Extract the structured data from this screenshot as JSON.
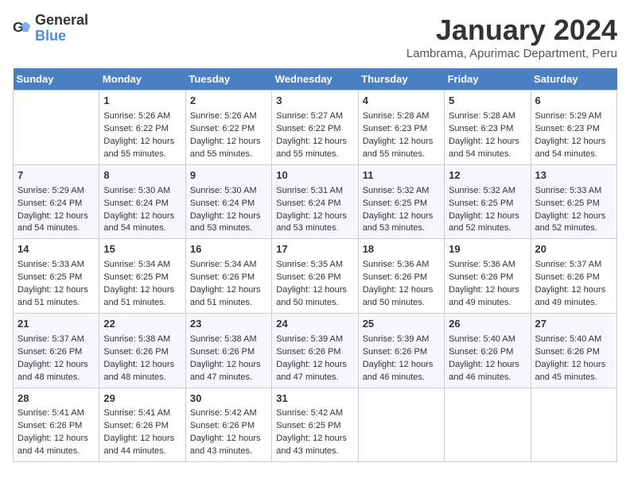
{
  "header": {
    "logo_general": "General",
    "logo_blue": "Blue",
    "month_title": "January 2024",
    "location": "Lambrama, Apurimac Department, Peru"
  },
  "days_of_week": [
    "Sunday",
    "Monday",
    "Tuesday",
    "Wednesday",
    "Thursday",
    "Friday",
    "Saturday"
  ],
  "weeks": [
    [
      {
        "day": "",
        "content": ""
      },
      {
        "day": "1",
        "content": "Sunrise: 5:26 AM\nSunset: 6:22 PM\nDaylight: 12 hours\nand 55 minutes."
      },
      {
        "day": "2",
        "content": "Sunrise: 5:26 AM\nSunset: 6:22 PM\nDaylight: 12 hours\nand 55 minutes."
      },
      {
        "day": "3",
        "content": "Sunrise: 5:27 AM\nSunset: 6:22 PM\nDaylight: 12 hours\nand 55 minutes."
      },
      {
        "day": "4",
        "content": "Sunrise: 5:28 AM\nSunset: 6:23 PM\nDaylight: 12 hours\nand 55 minutes."
      },
      {
        "day": "5",
        "content": "Sunrise: 5:28 AM\nSunset: 6:23 PM\nDaylight: 12 hours\nand 54 minutes."
      },
      {
        "day": "6",
        "content": "Sunrise: 5:29 AM\nSunset: 6:23 PM\nDaylight: 12 hours\nand 54 minutes."
      }
    ],
    [
      {
        "day": "7",
        "content": "Sunrise: 5:29 AM\nSunset: 6:24 PM\nDaylight: 12 hours\nand 54 minutes."
      },
      {
        "day": "8",
        "content": "Sunrise: 5:30 AM\nSunset: 6:24 PM\nDaylight: 12 hours\nand 54 minutes."
      },
      {
        "day": "9",
        "content": "Sunrise: 5:30 AM\nSunset: 6:24 PM\nDaylight: 12 hours\nand 53 minutes."
      },
      {
        "day": "10",
        "content": "Sunrise: 5:31 AM\nSunset: 6:24 PM\nDaylight: 12 hours\nand 53 minutes."
      },
      {
        "day": "11",
        "content": "Sunrise: 5:32 AM\nSunset: 6:25 PM\nDaylight: 12 hours\nand 53 minutes."
      },
      {
        "day": "12",
        "content": "Sunrise: 5:32 AM\nSunset: 6:25 PM\nDaylight: 12 hours\nand 52 minutes."
      },
      {
        "day": "13",
        "content": "Sunrise: 5:33 AM\nSunset: 6:25 PM\nDaylight: 12 hours\nand 52 minutes."
      }
    ],
    [
      {
        "day": "14",
        "content": "Sunrise: 5:33 AM\nSunset: 6:25 PM\nDaylight: 12 hours\nand 51 minutes."
      },
      {
        "day": "15",
        "content": "Sunrise: 5:34 AM\nSunset: 6:25 PM\nDaylight: 12 hours\nand 51 minutes."
      },
      {
        "day": "16",
        "content": "Sunrise: 5:34 AM\nSunset: 6:26 PM\nDaylight: 12 hours\nand 51 minutes."
      },
      {
        "day": "17",
        "content": "Sunrise: 5:35 AM\nSunset: 6:26 PM\nDaylight: 12 hours\nand 50 minutes."
      },
      {
        "day": "18",
        "content": "Sunrise: 5:36 AM\nSunset: 6:26 PM\nDaylight: 12 hours\nand 50 minutes."
      },
      {
        "day": "19",
        "content": "Sunrise: 5:36 AM\nSunset: 6:26 PM\nDaylight: 12 hours\nand 49 minutes."
      },
      {
        "day": "20",
        "content": "Sunrise: 5:37 AM\nSunset: 6:26 PM\nDaylight: 12 hours\nand 49 minutes."
      }
    ],
    [
      {
        "day": "21",
        "content": "Sunrise: 5:37 AM\nSunset: 6:26 PM\nDaylight: 12 hours\nand 48 minutes."
      },
      {
        "day": "22",
        "content": "Sunrise: 5:38 AM\nSunset: 6:26 PM\nDaylight: 12 hours\nand 48 minutes."
      },
      {
        "day": "23",
        "content": "Sunrise: 5:38 AM\nSunset: 6:26 PM\nDaylight: 12 hours\nand 47 minutes."
      },
      {
        "day": "24",
        "content": "Sunrise: 5:39 AM\nSunset: 6:26 PM\nDaylight: 12 hours\nand 47 minutes."
      },
      {
        "day": "25",
        "content": "Sunrise: 5:39 AM\nSunset: 6:26 PM\nDaylight: 12 hours\nand 46 minutes."
      },
      {
        "day": "26",
        "content": "Sunrise: 5:40 AM\nSunset: 6:26 PM\nDaylight: 12 hours\nand 46 minutes."
      },
      {
        "day": "27",
        "content": "Sunrise: 5:40 AM\nSunset: 6:26 PM\nDaylight: 12 hours\nand 45 minutes."
      }
    ],
    [
      {
        "day": "28",
        "content": "Sunrise: 5:41 AM\nSunset: 6:26 PM\nDaylight: 12 hours\nand 44 minutes."
      },
      {
        "day": "29",
        "content": "Sunrise: 5:41 AM\nSunset: 6:26 PM\nDaylight: 12 hours\nand 44 minutes."
      },
      {
        "day": "30",
        "content": "Sunrise: 5:42 AM\nSunset: 6:26 PM\nDaylight: 12 hours\nand 43 minutes."
      },
      {
        "day": "31",
        "content": "Sunrise: 5:42 AM\nSunset: 6:25 PM\nDaylight: 12 hours\nand 43 minutes."
      },
      {
        "day": "",
        "content": ""
      },
      {
        "day": "",
        "content": ""
      },
      {
        "day": "",
        "content": ""
      }
    ]
  ]
}
